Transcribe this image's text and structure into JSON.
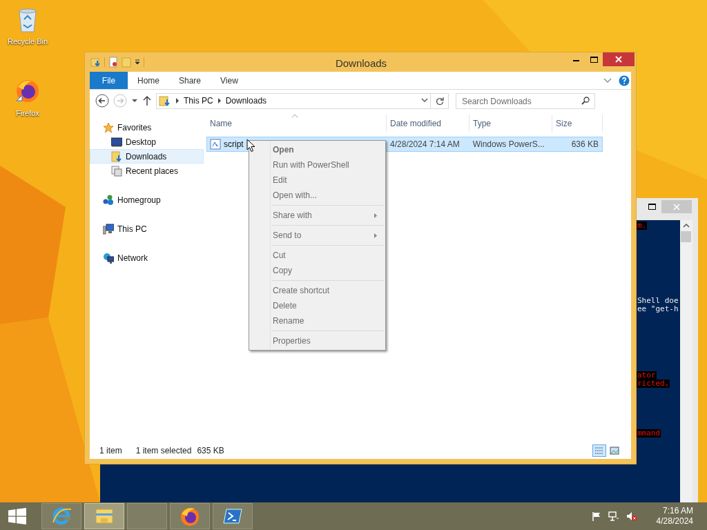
{
  "desktop_icons": [
    {
      "label": "Recycle Bin",
      "kind": "recycle-bin"
    },
    {
      "label": "Firefox",
      "kind": "firefox"
    }
  ],
  "console": {
    "lines": [
      {
        "text": "m.",
        "kind": "error"
      },
      {
        "text": "Shell doe",
        "kind": "normal"
      },
      {
        "text": "ee \"get-h",
        "kind": "normal"
      },
      {
        "text": "ator",
        "kind": "error"
      },
      {
        "text": "ricted,",
        "kind": "error"
      },
      {
        "text": "mmand",
        "kind": "error"
      }
    ]
  },
  "explorer": {
    "title": "Downloads",
    "ribbon_tabs": [
      {
        "label": "File",
        "kind": "file"
      },
      {
        "label": "Home",
        "kind": "tab"
      },
      {
        "label": "Share",
        "kind": "tab"
      },
      {
        "label": "View",
        "kind": "tab"
      }
    ],
    "address": [
      "This PC",
      "Downloads"
    ],
    "search": {
      "placeholder": "Search Downloads"
    },
    "nav": [
      {
        "label": "Favorites",
        "kind": "star",
        "selected": false,
        "children": [
          {
            "label": "Desktop",
            "kind": "desktop",
            "selected": false
          },
          {
            "label": "Downloads",
            "kind": "downloads",
            "selected": true
          },
          {
            "label": "Recent places",
            "kind": "recent",
            "selected": false
          }
        ]
      },
      {
        "label": "Homegroup",
        "kind": "homegroup",
        "selected": false
      },
      {
        "label": "This PC",
        "kind": "pc",
        "selected": false
      },
      {
        "label": "Network",
        "kind": "network",
        "selected": false
      }
    ],
    "columns": [
      "Name",
      "Date modified",
      "Type",
      "Size"
    ],
    "rows": [
      {
        "name": "script",
        "date": "4/28/2024 7:14 AM",
        "type": "Windows PowerS...",
        "size": "636 KB",
        "selected": true
      }
    ],
    "status": {
      "count": "1 item",
      "selection": "1 item selected",
      "selection_size": "635 KB"
    }
  },
  "context_menu": {
    "groups": [
      [
        {
          "label": "Open",
          "default": true,
          "submenu": false
        },
        {
          "label": "Run with PowerShell",
          "default": false,
          "submenu": false
        },
        {
          "label": "Edit",
          "default": false,
          "submenu": false
        },
        {
          "label": "Open with...",
          "default": false,
          "submenu": false
        }
      ],
      [
        {
          "label": "Share with",
          "default": false,
          "submenu": true
        }
      ],
      [
        {
          "label": "Send to",
          "default": false,
          "submenu": true
        }
      ],
      [
        {
          "label": "Cut",
          "default": false,
          "submenu": false
        },
        {
          "label": "Copy",
          "default": false,
          "submenu": false
        }
      ],
      [
        {
          "label": "Create shortcut",
          "default": false,
          "submenu": false
        },
        {
          "label": "Delete",
          "default": false,
          "submenu": false
        },
        {
          "label": "Rename",
          "default": false,
          "submenu": false
        }
      ],
      [
        {
          "label": "Properties",
          "default": false,
          "submenu": false
        }
      ]
    ]
  },
  "taskbar": {
    "apps": [
      {
        "kind": "ie",
        "active": false
      },
      {
        "kind": "explorer",
        "active": true
      },
      {
        "kind": "blank",
        "active": false
      },
      {
        "kind": "firefox",
        "active": false
      },
      {
        "kind": "powershell",
        "active": false
      }
    ],
    "time": "7:16 AM",
    "date": "4/28/2024"
  }
}
